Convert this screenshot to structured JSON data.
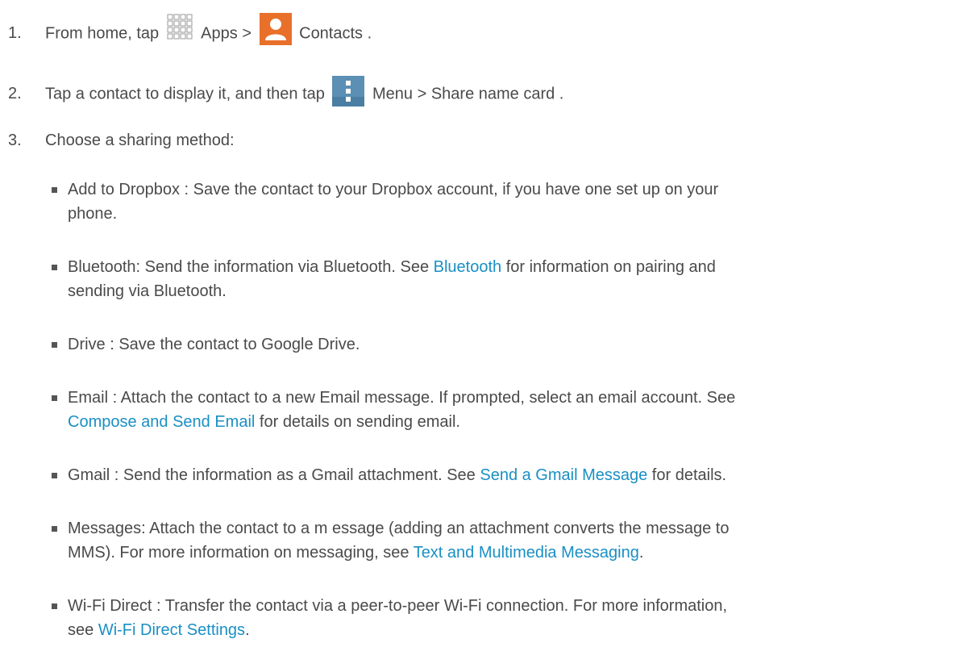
{
  "steps": [
    {
      "num": "1.",
      "text_a": "From home, tap ",
      "icon1": "apps-grid-icon",
      "text_b": " Apps  >  ",
      "icon2": "contacts-icon",
      "text_c": " Contacts ."
    },
    {
      "num": "2.",
      "text_a": "Tap a contact to display it, and then tap ",
      "icon1": "menu-icon",
      "text_b": " Menu  > Share  name  card ."
    },
    {
      "num": "3.",
      "text_a": "Choose a sharing method:"
    }
  ],
  "bullets": [
    {
      "lines": [
        "Add to Dropbox   : Save the contact to your Dropbox account, if you have one set up on your",
        "phone."
      ]
    },
    {
      "line1_pre": "Bluetooth:   Send the information via Bluetooth. See ",
      "line1_link": "Bluetooth",
      "line1_post": " for information on pairing and",
      "line2": "sending via Bluetooth."
    },
    {
      "text": "Drive : Save the contact to Google Drive."
    },
    {
      "line1": "Email : Attach the contact to a new Email message. If prompted, select an email account. See",
      "line2_link": "Compose and Send Email",
      "line2_post": " for details on sending email."
    },
    {
      "pre": "Gmail : Send the information as a Gmail attachment. See ",
      "link": "Send a Gmail Message",
      "post": " for details."
    },
    {
      "line1": "Messages: Attach the contact to a m essage (adding an attachment converts the message to",
      "line2_pre": "MMS). For more information on messaging, see ",
      "line2_link": "Text and Multimedia Messaging",
      "line2_post": "."
    },
    {
      "line1": "Wi-Fi Direct : Transfer the contact via a peer-to-peer Wi-Fi connection. For more information,",
      "line2_pre": "see ",
      "line2_link": "Wi-Fi Direct Settings",
      "line2_post": "."
    }
  ],
  "colors": {
    "text": "#4a4a4a",
    "link": "#1a8fc4",
    "contacts_icon_bg": "#e8702a",
    "menu_icon_bg": "#5b8fb3"
  }
}
